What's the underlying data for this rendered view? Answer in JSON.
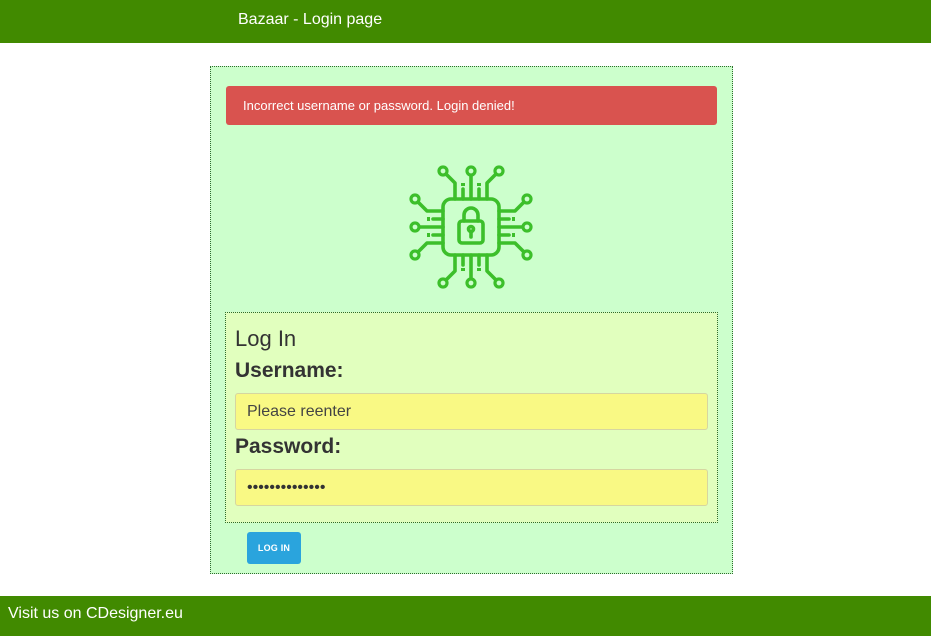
{
  "header": {
    "title": "Bazaar - Login page"
  },
  "alert": {
    "message": "Incorrect username or password. Login denied!",
    "color": "#d9534f"
  },
  "logo": {
    "icon": "circuit-lock-icon",
    "color": "#3cbf2a"
  },
  "form": {
    "heading": "Log In",
    "username_label": "Username:",
    "username_placeholder": "Please reenter",
    "username_value": "",
    "password_label": "Password:",
    "password_value": "**************",
    "submit_label": "LOG IN"
  },
  "footer": {
    "text": "Visit us on CDesigner.eu"
  },
  "colors": {
    "brand_green": "#418a00",
    "panel_bg": "#ccffcc",
    "form_bg": "#e1ffbe",
    "input_bg": "#f9f984",
    "button_blue": "#2aa4dd"
  }
}
